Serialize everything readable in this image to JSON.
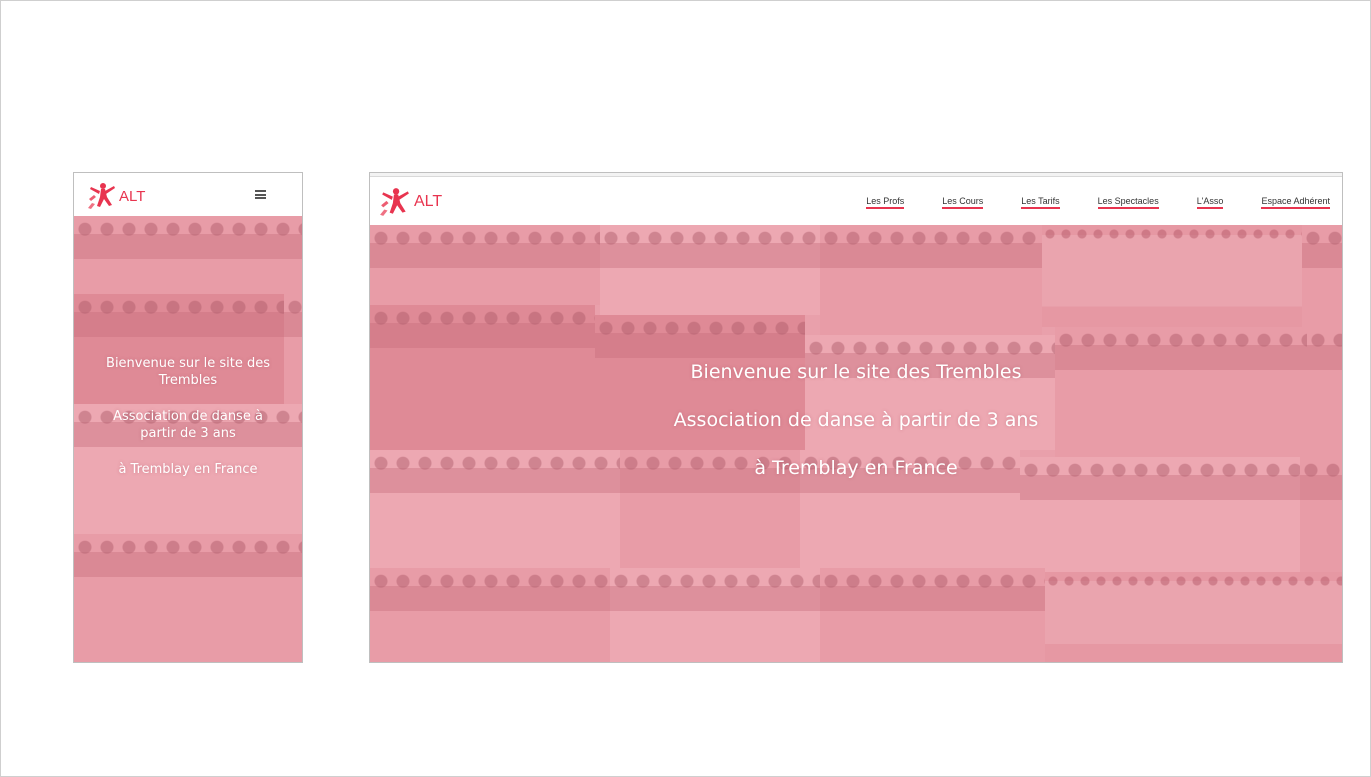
{
  "brand": {
    "logo_text": "ALT",
    "accent_color": "#e8344f",
    "hero_tint": "#e9a7af"
  },
  "mobile": {
    "menu_icon": "hamburger-menu-icon",
    "hero": {
      "line1": "Bienvenue sur le site des Trembles",
      "line2": "Association de danse à partir de 3 ans",
      "line3": "à Tremblay en France"
    }
  },
  "desktop": {
    "nav": [
      {
        "label": "Les Profs"
      },
      {
        "label": "Les Cours"
      },
      {
        "label": "Les Tarifs"
      },
      {
        "label": "Les Spectacles"
      },
      {
        "label": "L'Asso"
      },
      {
        "label": "Espace Adhérent"
      }
    ],
    "hero": {
      "line1": "Bienvenue sur le site des Trembles",
      "line2": "Association de danse à partir de 3 ans",
      "line3": "à Tremblay en France"
    }
  }
}
